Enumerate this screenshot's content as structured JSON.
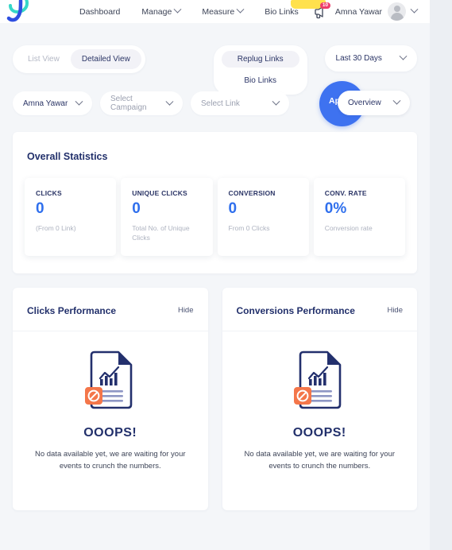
{
  "header": {
    "logo_icon": "replug-logo-icon",
    "nav": [
      {
        "label": "Dashboard",
        "has_caret": false
      },
      {
        "label": "Manage",
        "has_caret": true
      },
      {
        "label": "Measure",
        "has_caret": true
      },
      {
        "label": "Bio Links",
        "has_caret": false
      }
    ],
    "notification": {
      "icon": "megaphone-icon",
      "count": "10",
      "badge_color": "#ee3d6b"
    },
    "user": {
      "name": "Amna Yawar",
      "avatar_icon": "user-avatar-icon",
      "caret_icon": "chevron-down-icon"
    }
  },
  "toolbar": {
    "view_toggle": {
      "options": [
        "List View",
        "Detailed View"
      ],
      "selected": "Detailed View"
    },
    "link_type_toggle": {
      "options": [
        "Replug Links",
        "Bio Links"
      ],
      "selected": "Replug Links"
    },
    "date_range": {
      "value": "Last 30 Days",
      "caret_icon": "chevron-down-icon"
    }
  },
  "filters": {
    "workspace": {
      "value": "Amna Yawar",
      "caret_icon": "chevron-down-icon"
    },
    "campaign": {
      "placeholder": "Select Campaign",
      "value": "Select Campaign",
      "caret_icon": "chevron-down-icon"
    },
    "link": {
      "placeholder": "Select Link",
      "value": "Select Link",
      "caret_icon": "chevron-down-icon"
    },
    "apply_button": {
      "label": "Apply",
      "color": "#3e72f0"
    },
    "overview_dropdown": {
      "value": "Overview",
      "caret_icon": "chevron-down-icon"
    }
  },
  "statistics": {
    "title": "Overall Statistics",
    "cards": [
      {
        "label": "CLICKS",
        "value": "0",
        "sub": "(From 0 Link)"
      },
      {
        "label": "UNIQUE CLICKS",
        "value": "0",
        "sub": "Total No. of Unique Clicks"
      },
      {
        "label": "CONVERSION",
        "value": "0",
        "sub": "From 0 Clicks"
      },
      {
        "label": "CONV. RATE",
        "value": "0%",
        "sub": "Conversion rate"
      }
    ],
    "value_color": "#2f6fed"
  },
  "performance": {
    "clicks": {
      "title": "Clicks Performance",
      "hide_label": "Hide",
      "empty_icon": "no-data-document-icon",
      "empty_title": "OOOPS!",
      "empty_message": "No data available yet, we are waiting for your events to crunch the numbers."
    },
    "conversions": {
      "title": "Conversions Performance",
      "hide_label": "Hide",
      "empty_icon": "no-data-document-icon",
      "empty_title": "OOOPS!",
      "empty_message": "No data available yet, we are waiting for your events to crunch the numbers."
    }
  }
}
